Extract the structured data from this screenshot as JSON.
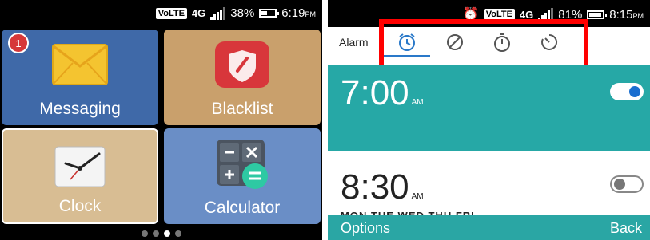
{
  "left": {
    "status": {
      "volte": "VoLTE",
      "network": "4G",
      "battery": "38%",
      "battery_level": 0.38,
      "time": "6:19",
      "ampm": "PM"
    },
    "tiles": {
      "messaging": {
        "label": "Messaging",
        "badge": "1"
      },
      "blacklist": {
        "label": "Blacklist"
      },
      "clock": {
        "label": "Clock"
      },
      "calculator": {
        "label": "Calculator"
      }
    },
    "page_indicator": {
      "count": 4,
      "active": 2
    }
  },
  "right": {
    "status": {
      "volte": "VoLTE",
      "network": "4G",
      "battery": "81%",
      "battery_level": 0.81,
      "time": "8:15",
      "ampm": "PM"
    },
    "tabs": {
      "title": "Alarm",
      "items": [
        {
          "name": "alarm",
          "active": true
        },
        {
          "name": "world-clock",
          "active": false
        },
        {
          "name": "stopwatch",
          "active": false
        },
        {
          "name": "timer",
          "active": false
        }
      ]
    },
    "alarms": [
      {
        "time": "7:00",
        "ampm": "AM",
        "enabled": true
      },
      {
        "time": "8:30",
        "ampm": "AM",
        "enabled": false,
        "days": "MON TUE WED THU FRI"
      }
    ],
    "bottom": {
      "left_label": "Options",
      "right_label": "Back"
    },
    "colors": {
      "accent": "#26a8a6",
      "tab_indicator": "#2a79c9",
      "highlight": "#ff0000"
    }
  }
}
